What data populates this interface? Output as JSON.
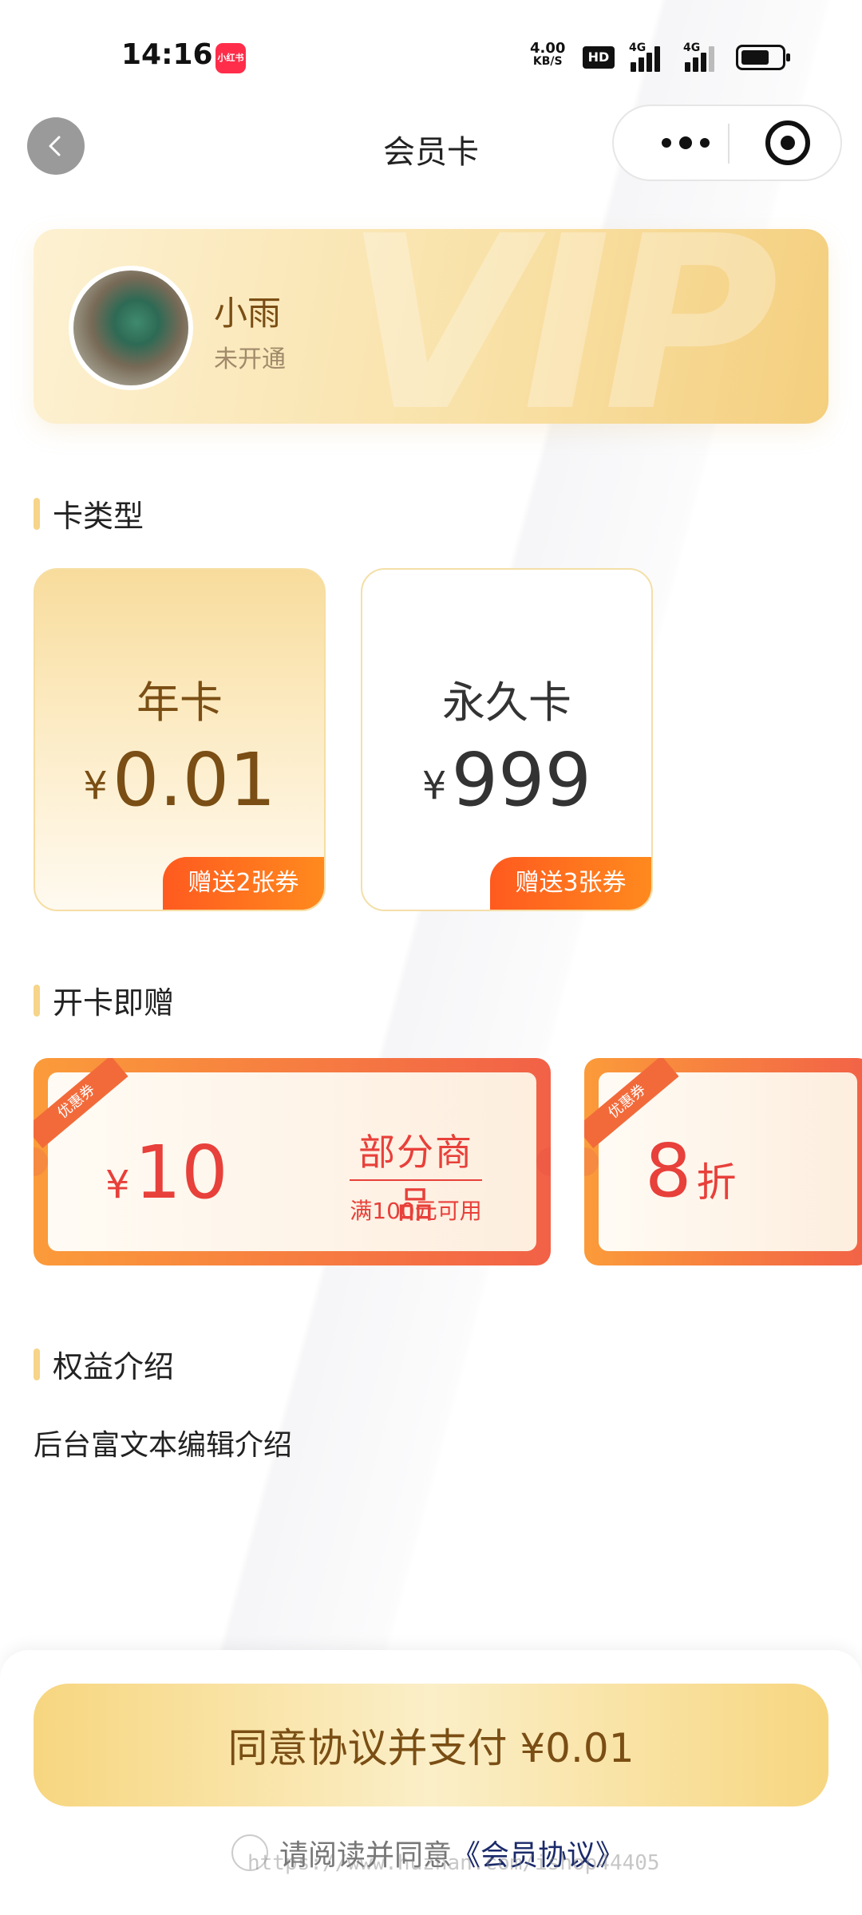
{
  "status_bar": {
    "time": "14:16",
    "app_badge": "小红书",
    "net_speed_value": "4.00",
    "net_speed_unit": "KB/S",
    "hd": "HD",
    "signal_1": "4G",
    "signal_2": "4G"
  },
  "nav": {
    "title": "会员卡"
  },
  "member": {
    "name": "小雨",
    "status": "未开通",
    "watermark": "VIP"
  },
  "sections": {
    "card_type": "卡类型",
    "gifts": "开卡即赠",
    "benefits": "权益介绍"
  },
  "card_types": [
    {
      "name": "年卡",
      "currency": "¥",
      "price": "0.01",
      "gift": "赠送2张券",
      "selected": true
    },
    {
      "name": "永久卡",
      "currency": "¥",
      "price": "999",
      "gift": "赠送3张券",
      "selected": false
    }
  ],
  "coupons": [
    {
      "ribbon": "优惠券",
      "currency": "¥",
      "amount": "10",
      "title": "部分商品",
      "condition": "满100元可用"
    },
    {
      "ribbon": "优惠券",
      "amount": "8",
      "unit": "折"
    }
  ],
  "benefit_text": "后台富文本编辑介绍",
  "pay_button": "同意协议并支付 ¥0.01",
  "agreement": {
    "prefix": "请阅读并同意",
    "link": "《会员协议》"
  },
  "watermark": "https://www.huzhan.com/ishop44405",
  "colors": {
    "accent_gold": "#f6d489",
    "brown_text": "#7a4e14",
    "coupon_red": "#e8403a",
    "gift_orange": "#ff5a1f"
  }
}
